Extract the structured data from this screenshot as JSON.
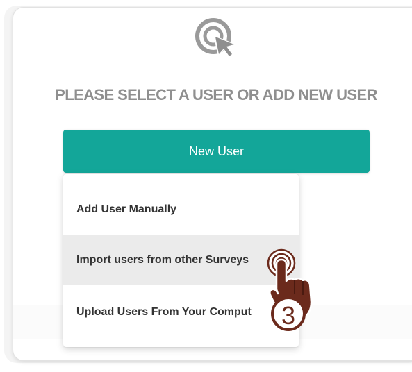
{
  "header": {
    "icon": "cursor-click-icon",
    "title": "PLEASE SELECT A USER OR ADD NEW USER"
  },
  "button": {
    "label": "New User",
    "color": "#13a699"
  },
  "menu": {
    "items": [
      {
        "label": "Add User Manually",
        "highlighted": false
      },
      {
        "label": "Import users from other Surveys",
        "highlighted": true
      },
      {
        "label": "Upload Users From Your Comput",
        "highlighted": false
      }
    ]
  },
  "annotation": {
    "step_number": "3",
    "icon": "tap-hand-icon",
    "color": "#6b2a1c"
  }
}
